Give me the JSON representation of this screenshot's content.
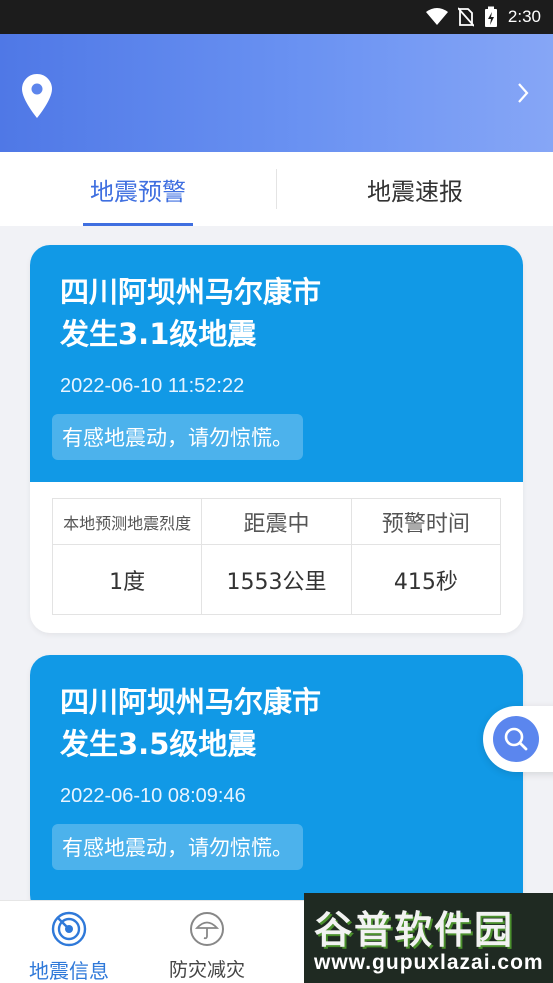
{
  "status_bar": {
    "time": "2:30",
    "icons": [
      "wifi-icon",
      "no-sim-icon",
      "battery-charging-icon"
    ]
  },
  "header": {
    "icons": [
      "location-pin-icon",
      "chevron-right-icon"
    ]
  },
  "tabs": [
    {
      "label": "地震预警",
      "active": true
    },
    {
      "label": "地震速报",
      "active": false
    }
  ],
  "cards": [
    {
      "title": "四川阿坝州马尔康市\n发生3.1级地震",
      "time": "2022-06-10 11:52:22",
      "tag": "有感地震动，请勿惊慌。",
      "table": {
        "headers": [
          "本地预测地震烈度",
          "距震中",
          "预警时间"
        ],
        "values": [
          "1度",
          "1553公里",
          "415秒"
        ]
      }
    },
    {
      "title": "四川阿坝州马尔康市\n发生3.5级地震",
      "time": "2022-06-10 08:09:46",
      "tag": "有感地震动，请勿惊慌。"
    }
  ],
  "fab": {
    "icon": "search-icon"
  },
  "bottom_nav": [
    {
      "label": "地震信息",
      "icon": "radar-icon",
      "active": true
    },
    {
      "label": "防灾减灾",
      "icon": "umbrella-icon",
      "active": false
    }
  ],
  "watermark": {
    "title": "谷普软件园",
    "url": "www.gupuxlazai.com"
  },
  "colors": {
    "accent": "#3f6fe0",
    "card_blue": "#1199e6",
    "header_start": "#4f78e6",
    "header_end": "#86a6f6"
  }
}
